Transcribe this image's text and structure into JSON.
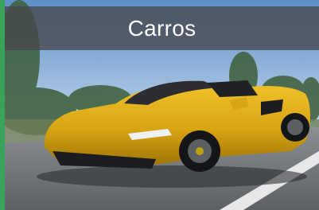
{
  "card": {
    "title": "Carros",
    "image_icon": "car-photo",
    "colors": {
      "accent_edge": "#3aa35a",
      "car_body": "#d9a514",
      "title_bar": "#46484c"
    }
  }
}
